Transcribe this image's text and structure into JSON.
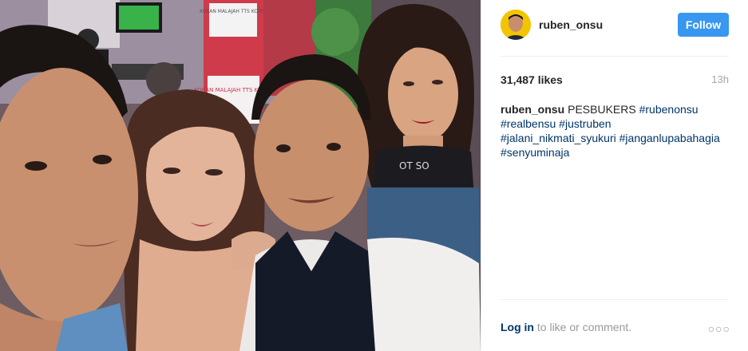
{
  "post": {
    "username": "ruben_onsu",
    "follow_label": "Follow",
    "likes": "31,487 likes",
    "time": "13h",
    "caption": {
      "user": "ruben_onsu",
      "text": "PESBUKERS",
      "tags": [
        "#rubenonsu",
        "#realbensu",
        "#justruben",
        "#jalani_nikmati_syukuri",
        "#janganlupabahagia",
        "#senyuminaja"
      ]
    },
    "footer": {
      "login_label": "Log in",
      "rest": " to like or comment."
    },
    "more_label": "○○○"
  },
  "photo": {
    "sign_text_1": "KORAN MALAJAH TTS KOMIK",
    "sign_text_2": "KORAN MALAJAH TTS KOMIK",
    "shirt_text": "OT SO"
  },
  "colors": {
    "follow_bg": "#3897f0",
    "link": "#003569",
    "avatar_bg": "#f2c500"
  }
}
